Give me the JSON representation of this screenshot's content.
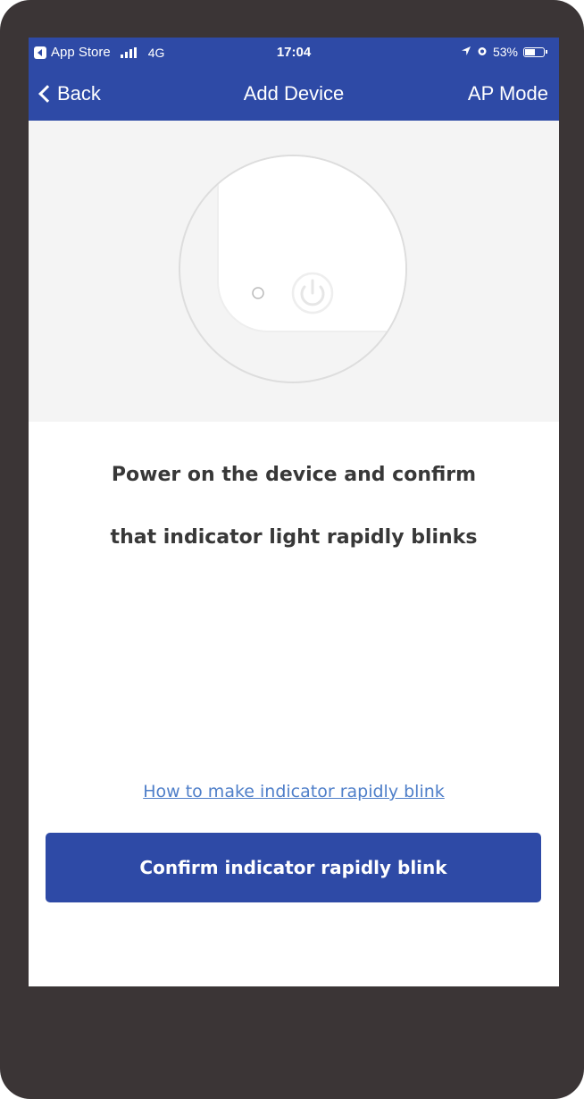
{
  "status_bar": {
    "carrier_back": "App Store",
    "network": "4G",
    "time": "17:04",
    "battery_percent": "53%",
    "icons": [
      "app-store-icon",
      "signal-icon",
      "location-icon",
      "alarm-icon",
      "battery-icon"
    ]
  },
  "nav": {
    "back_label": "Back",
    "title": "Add Device",
    "mode_label": "AP Mode"
  },
  "illustration": {
    "icons": [
      "device-outline",
      "indicator-light-icon",
      "power-icon"
    ]
  },
  "instructions": {
    "line1": "Power on the device and confirm",
    "line2": "that indicator light rapidly blinks"
  },
  "help_link": "How to make indicator rapidly blink",
  "confirm_button": "Confirm indicator rapidly blink",
  "colors": {
    "primary": "#2e4aa6",
    "link": "#4f7fc9",
    "text": "#383838",
    "frame": "#3b3536"
  }
}
